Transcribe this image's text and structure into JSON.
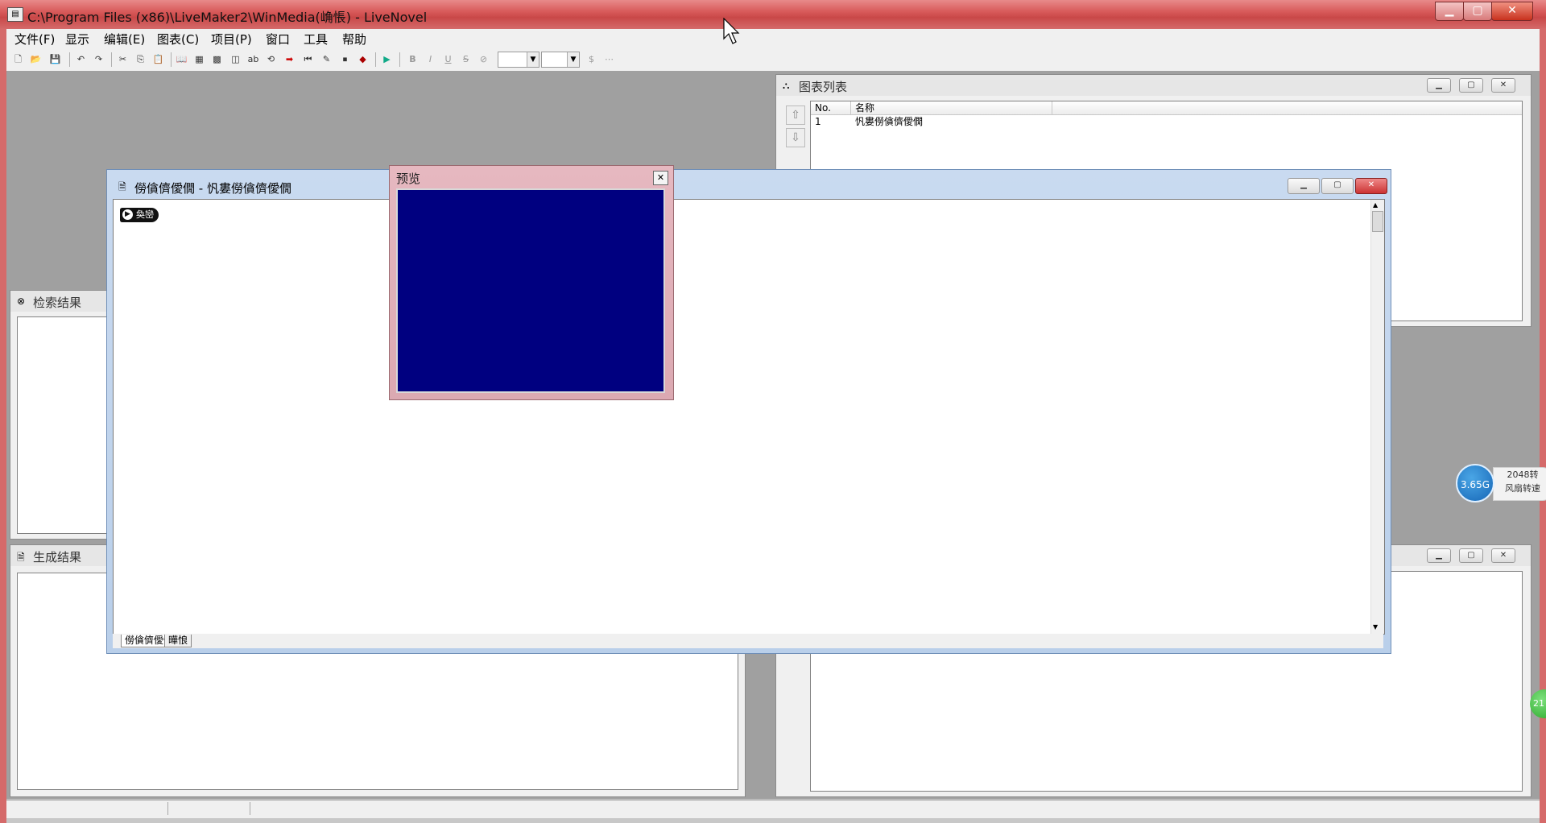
{
  "window": {
    "title": "C:\\Program Files (x86)\\LiveMaker2\\WinMedia(崅悵) - LiveNovel"
  },
  "menu": [
    "文件(F)",
    "显示",
    "编辑(E)",
    "图表(C)",
    "项目(P)",
    "窗口",
    "工具",
    "帮助"
  ],
  "toolbar": {
    "format_buttons": [
      "B",
      "I",
      "U",
      "S"
    ]
  },
  "chart_list": {
    "title": "图表列表",
    "columns": [
      "No.",
      "名称"
    ],
    "rows": [
      {
        "no": "1",
        "name": "忛婁僗僋儕僾僩"
      }
    ]
  },
  "search_results": {
    "title": "检索结果"
  },
  "build_results": {
    "title": "生成结果"
  },
  "editor": {
    "title": "僗僋儕僾僩 - 忛婁僗僋儕僾僩",
    "start_node_label": "奐巒",
    "tabs": [
      "僗僋儕僾僩",
      "曄悢"
    ]
  },
  "preview": {
    "title": "预览",
    "screen_color": "#000080"
  },
  "speed_widget": {
    "memory": "3.65G",
    "rpm": "2048转",
    "label": "风扇转速"
  },
  "tray_ball": {
    "value": "21"
  }
}
